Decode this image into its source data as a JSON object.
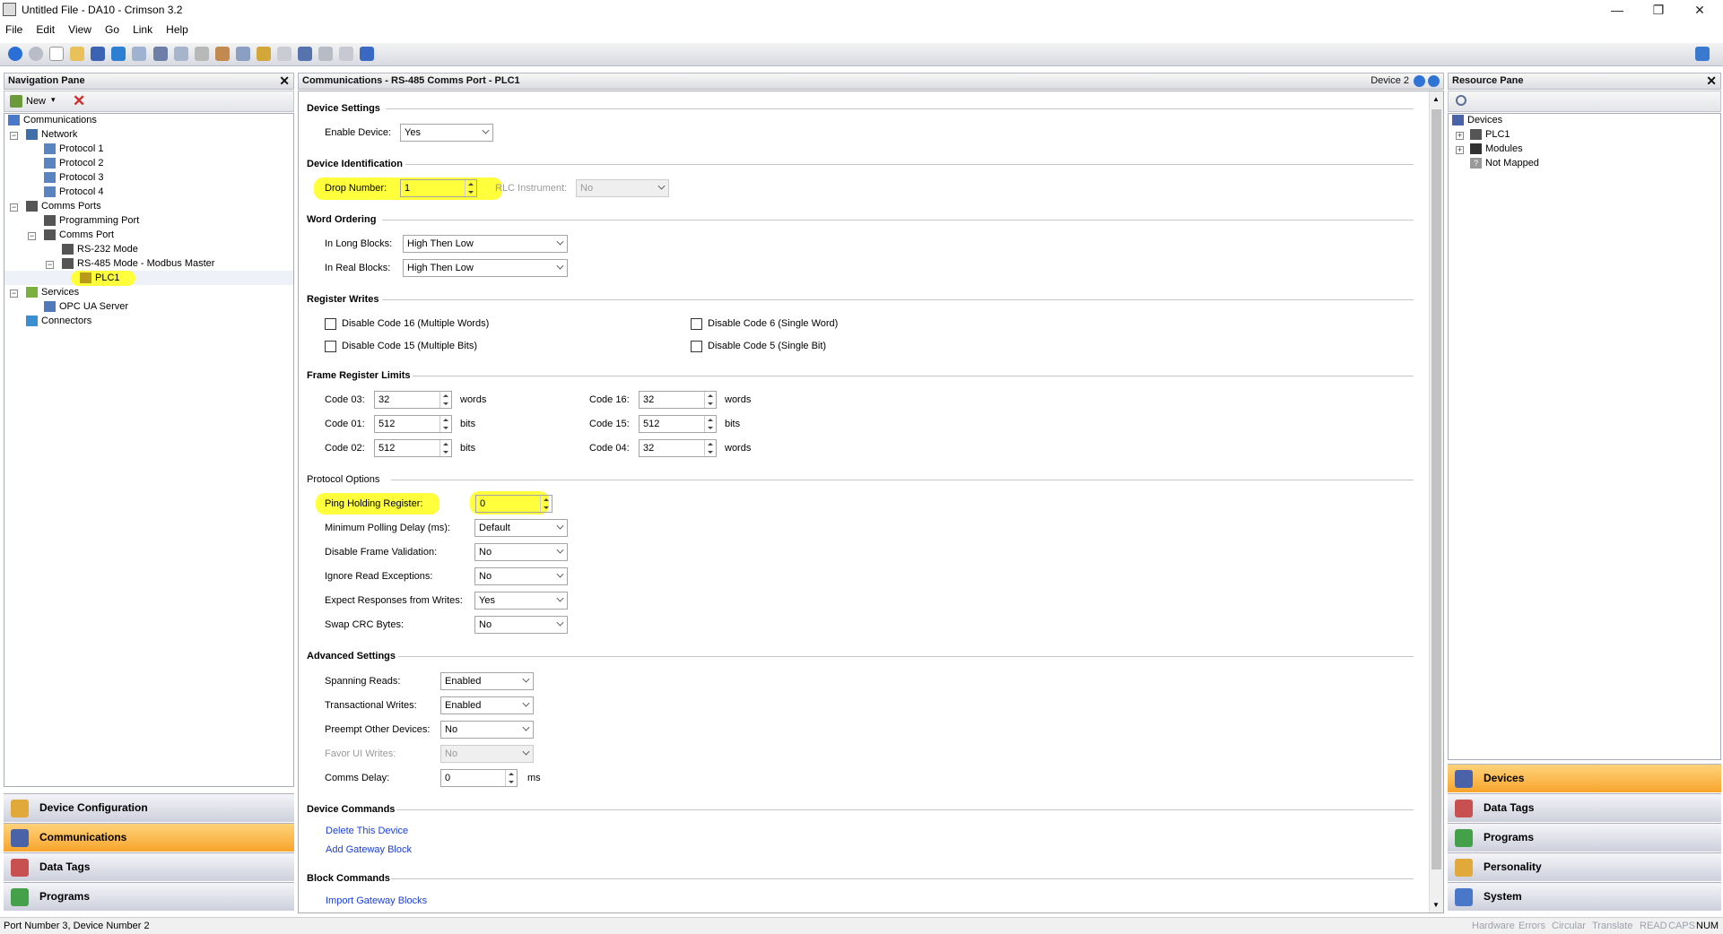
{
  "window": {
    "title": "Untitled File - DA10 - Crimson 3.2"
  },
  "menu": [
    "File",
    "Edit",
    "View",
    "Go",
    "Link",
    "Help"
  ],
  "nav": {
    "title": "Navigation Pane",
    "new_label": "New",
    "tree": [
      {
        "label": "Communications"
      },
      {
        "label": "Network"
      },
      {
        "label": "Protocol 1"
      },
      {
        "label": "Protocol 2"
      },
      {
        "label": "Protocol 3"
      },
      {
        "label": "Protocol 4"
      },
      {
        "label": "Comms Ports"
      },
      {
        "label": "Programming Port"
      },
      {
        "label": "Comms Port"
      },
      {
        "label": "RS-232 Mode"
      },
      {
        "label": "RS-485 Mode - Modbus Master"
      },
      {
        "label": "PLC1"
      },
      {
        "label": "Services"
      },
      {
        "label": "OPC UA Server"
      },
      {
        "label": "Connectors"
      }
    ],
    "buttons": [
      "Device Configuration",
      "Communications",
      "Data Tags",
      "Programs"
    ]
  },
  "main": {
    "header": "Communications - RS-485 Comms Port - PLC1",
    "device_nav": "Device 2",
    "device_settings": {
      "title": "Device Settings",
      "enable_label": "Enable Device:",
      "enable_value": "Yes"
    },
    "device_identification": {
      "title": "Device Identification",
      "drop_label": "Drop Number:",
      "drop_value": "1",
      "rlc_label": "RLC Instrument:",
      "rlc_value": "No"
    },
    "word_ordering": {
      "title": "Word Ordering",
      "long_label": "In Long Blocks:",
      "long_value": "High Then Low",
      "real_label": "In Real Blocks:",
      "real_value": "High Then Low"
    },
    "register_writes": {
      "title": "Register Writes",
      "items": [
        "Disable Code 16 (Multiple Words)",
        "Disable Code 6 (Single Word)",
        "Disable Code 15 (Multiple Bits)",
        "Disable Code 5 (Single Bit)"
      ]
    },
    "frame_limits": {
      "title": "Frame Register Limits",
      "rows": [
        {
          "label": "Code 03:",
          "value": "32",
          "unit": "words"
        },
        {
          "label": "Code 01:",
          "value": "512",
          "unit": "bits"
        },
        {
          "label": "Code 02:",
          "value": "512",
          "unit": "bits"
        },
        {
          "label": "Code 16:",
          "value": "32",
          "unit": "words"
        },
        {
          "label": "Code 15:",
          "value": "512",
          "unit": "bits"
        },
        {
          "label": "Code 04:",
          "value": "32",
          "unit": "words"
        }
      ]
    },
    "protocol_options": {
      "title": "Protocol Options",
      "ping_label": "Ping Holding Register:",
      "ping_value": "0",
      "rows": [
        {
          "label": "Minimum Polling Delay (ms):",
          "value": "Default"
        },
        {
          "label": "Disable Frame Validation:",
          "value": "No"
        },
        {
          "label": "Ignore Read Exceptions:",
          "value": "No"
        },
        {
          "label": "Expect Responses from Writes:",
          "value": "Yes"
        },
        {
          "label": "Swap CRC Bytes:",
          "value": "No"
        }
      ]
    },
    "advanced": {
      "title": "Advanced Settings",
      "rows": [
        {
          "label": "Spanning Reads:",
          "value": "Enabled"
        },
        {
          "label": "Transactional Writes:",
          "value": "Enabled"
        },
        {
          "label": "Preempt Other Devices:",
          "value": "No"
        },
        {
          "label": "Favor UI Writes:",
          "value": "No"
        }
      ],
      "delay_label": "Comms Delay:",
      "delay_value": "0",
      "delay_unit": "ms"
    },
    "device_commands": {
      "title": "Device Commands",
      "links": [
        "Delete This Device",
        "Add Gateway Block"
      ]
    },
    "block_commands": {
      "title": "Block Commands",
      "links": [
        "Import Gateway Blocks"
      ]
    }
  },
  "resource": {
    "title": "Resource Pane",
    "tree": [
      "Devices",
      "PLC1",
      "Modules",
      "Not Mapped"
    ],
    "buttons": [
      "Devices",
      "Data Tags",
      "Programs",
      "Personality",
      "System"
    ]
  },
  "status": {
    "text": "Port Number 3, Device Number 2",
    "indicators": [
      "Hardware",
      "Errors",
      "Circular",
      "Translate",
      "READ",
      "CAPS",
      "NUM"
    ]
  },
  "colors": {
    "highlight": "#ffff3c",
    "selected_button": "#f7a52c",
    "link": "#1c3fd6"
  }
}
